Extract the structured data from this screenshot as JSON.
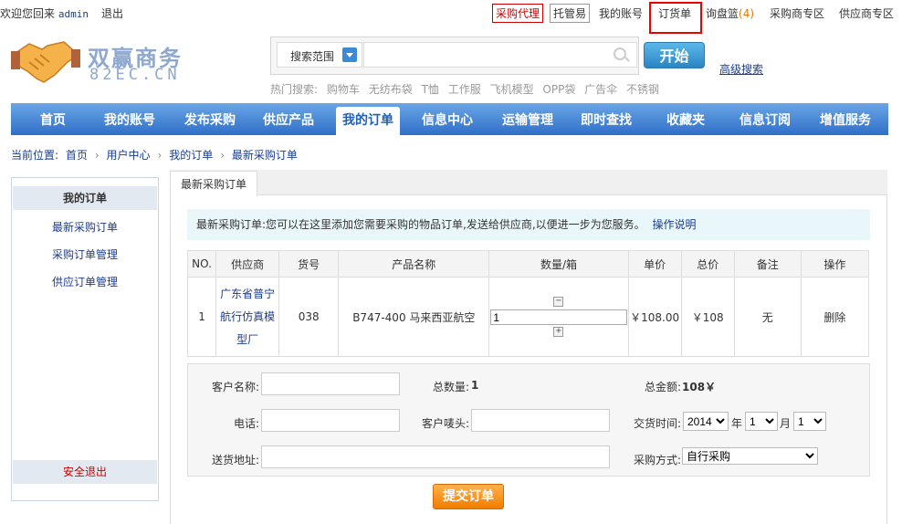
{
  "topbar": {
    "greeting": "欢迎您回来",
    "username": "admin",
    "logout": "退出",
    "links": {
      "purchase_agent": "采购代理",
      "escrow": "托管易",
      "my_account": "我的账号",
      "order_list": "订货单",
      "inquiry_basket": "询盘篮",
      "inquiry_count": "(4)",
      "buyer_zone": "采购商专区",
      "supplier_zone": "供应商专区"
    }
  },
  "logo": {
    "title": "双赢商务",
    "subtitle": "82EC.CN"
  },
  "search": {
    "scope_label": "搜索范围",
    "placeholder": "",
    "button": "开始",
    "advanced": "高级搜索",
    "hot_label": "热门搜索:",
    "hot_terms": [
      "购物车",
      "无纺布袋",
      "T恤",
      "工作服",
      "飞机模型",
      "OPP袋",
      "广告伞",
      "不锈钢"
    ]
  },
  "nav": {
    "items": [
      "首页",
      "我的账号",
      "发布采购",
      "供应产品",
      "我的订单",
      "信息中心",
      "运输管理",
      "即时查找",
      "收藏夹",
      "信息订阅",
      "增值服务"
    ]
  },
  "breadcrumb": {
    "prefix": "当前位置:",
    "items": [
      "首页",
      "用户中心",
      "我的订单",
      "最新采购订单"
    ]
  },
  "sidebar": {
    "heading": "我的订单",
    "items": [
      "最新采购订单",
      "采购订单管理",
      "供应订单管理"
    ],
    "exit": "安全退出"
  },
  "main": {
    "tab": "最新采购订单",
    "notice": "最新采购订单:您可以在这里添加您需要采购的物品订单,发送给供应商,以便进一步为您服务。",
    "notice_link": "操作说明",
    "table": {
      "headers": [
        "NO.",
        "供应商",
        "货号",
        "产品名称",
        "数量/箱",
        "单价",
        "总价",
        "备注",
        "操作"
      ],
      "rows": [
        {
          "no": "1",
          "supplier_lines": [
            "广东省普宁",
            "航行仿真模",
            "型厂"
          ],
          "sku": "038",
          "product": "B747-400 马来西亚航空",
          "qty": "1",
          "unit_price": "￥108.00",
          "total": "￥108",
          "remark": "无",
          "action": "删除"
        }
      ]
    },
    "form": {
      "customer_name_label": "客户名称:",
      "total_qty_label": "总数量:",
      "total_qty": "1",
      "total_amount_label": "总金额:",
      "total_amount": "108￥",
      "phone_label": "电话:",
      "mark_label": "客户唛头:",
      "delivery_label": "交货时间:",
      "year": "2014",
      "year_unit": "年",
      "month": "1",
      "month_unit": "月",
      "day": "1",
      "address_label": "送货地址:",
      "method_label": "采购方式:",
      "method": "自行采购"
    },
    "submit": "提交订单"
  }
}
